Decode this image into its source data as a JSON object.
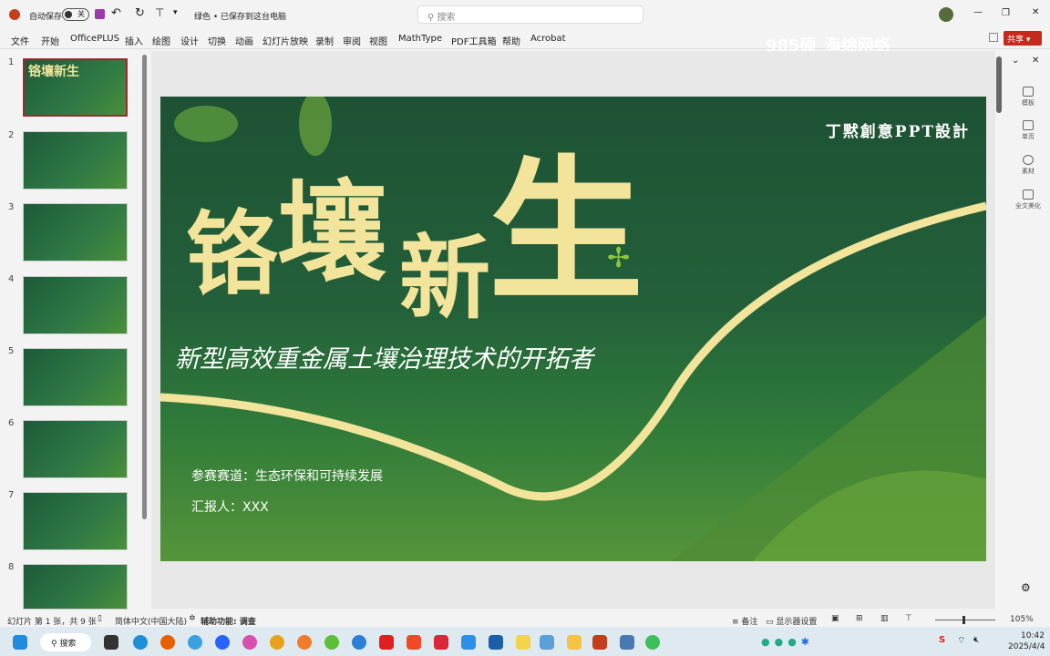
{
  "titlebar": {
    "autosave_label": "自动保存",
    "autosave_state": "关",
    "doc_title": "绿色 • 已保存到这台电脑",
    "search_placeholder": "搜索"
  },
  "ribbon": {
    "tabs": [
      "文件",
      "开始",
      "OfficePLUS",
      "插入",
      "绘图",
      "设计",
      "切换",
      "动画",
      "幻灯片放映",
      "录制",
      "审阅",
      "视图",
      "MathType",
      "PDF工具箱",
      "帮助",
      "Acrobat"
    ],
    "share_label": "共享",
    "watermark": "985硕_海绵网络"
  },
  "thumbnails": {
    "numbers": [
      "1",
      "2",
      "3",
      "4",
      "5",
      "6",
      "7",
      "8"
    ],
    "selected": 1
  },
  "slide": {
    "brand": "丁黙創意PPT設計",
    "title_chars": [
      "铬",
      "壤",
      "新",
      "生"
    ],
    "subtitle": "新型高效重金属土壤治理技术的开拓者",
    "track": "参赛赛道：生态环保和可持续发展",
    "reporter": "汇报人：XXX"
  },
  "right_pane": {
    "items": [
      "模板",
      "单页",
      "素材",
      "全文美化"
    ]
  },
  "statusbar": {
    "slide_info": "幻灯片 第 1 张，共 9 张",
    "language": "简体中文(中国大陆)",
    "accessibility": "辅助功能: 调查",
    "notes": "备注",
    "display_settings": "显示器设置",
    "zoom": "105%"
  },
  "taskbar": {
    "search": "搜索",
    "time": "10:42",
    "date": "2025/4/4"
  },
  "colors": {
    "accent": "#b7472a",
    "slide_green": "#1d5234",
    "ribbon_gold": "#f2e49a"
  }
}
